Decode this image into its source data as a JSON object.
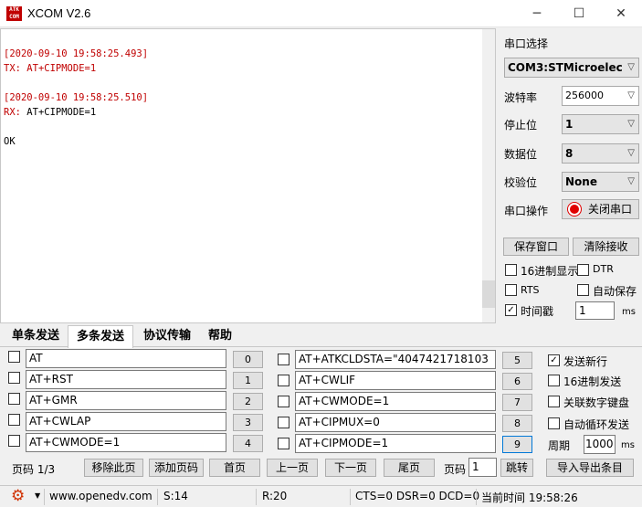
{
  "window": {
    "title": "XCOM V2.6",
    "icon_text_top": "ATK",
    "icon_text_bottom": "COM",
    "minimize": "─",
    "maximize": "☐",
    "close": "✕"
  },
  "receive": {
    "lines": [
      {
        "text": "[2020-09-10 19:58:25.493]",
        "color": "#c00000"
      },
      {
        "prefix": "TX: ",
        "text": "AT+CIPMODE=1",
        "color": "#c00000"
      },
      {
        "text": "[2020-09-10 19:58:25.510]",
        "color": "#c00000"
      },
      {
        "prefix": "RX: ",
        "text": "AT+CIPMODE=1",
        "color": "#000000"
      },
      {
        "text": "OK",
        "color": "#000000"
      }
    ]
  },
  "serial": {
    "select_label": "串口选择",
    "port": "COM3:STMicroelec",
    "baud_label": "波特率",
    "baud": "256000",
    "stop_label": "停止位",
    "stop": "1",
    "data_label": "数据位",
    "data_bits": "8",
    "parity_label": "校验位",
    "parity": "None",
    "op_label": "串口操作",
    "op_button": "关闭串口",
    "save_window": "保存窗口",
    "clear_receive": "清除接收",
    "hex_display": "16进制显示",
    "dtr": "DTR",
    "rts": "RTS",
    "auto_save": "自动保存",
    "timestamp": "时间戳",
    "timestamp_checked": true,
    "timestamp_value": "1",
    "timestamp_unit": "ms"
  },
  "tabs": [
    "单条发送",
    "多条发送",
    "协议传输",
    "帮助"
  ],
  "active_tab": 1,
  "multi": {
    "left": [
      {
        "cmd": "AT",
        "num": "0"
      },
      {
        "cmd": "AT+RST",
        "num": "1"
      },
      {
        "cmd": "AT+GMR",
        "num": "2"
      },
      {
        "cmd": "AT+CWLAP",
        "num": "3"
      },
      {
        "cmd": "AT+CWMODE=1",
        "num": "4"
      }
    ],
    "right": [
      {
        "cmd": "AT+ATKCLDSTA=\"4047421718103",
        "num": "5"
      },
      {
        "cmd": "AT+CWLIF",
        "num": "6"
      },
      {
        "cmd": "AT+CWMODE=1",
        "num": "7"
      },
      {
        "cmd": "AT+CIPMUX=0",
        "num": "8"
      },
      {
        "cmd": "AT+CIPMODE=1",
        "num": "9"
      }
    ],
    "send_newline": "发送新行",
    "send_newline_checked": true,
    "hex_send": "16进制发送",
    "link_keyboard": "关联数字键盘",
    "auto_loop": "自动循环发送",
    "period_label": "周期",
    "period_value": "1000",
    "period_unit": "ms",
    "page_label": "页码 1/3",
    "remove_page": "移除此页",
    "add_page": "添加页码",
    "first_page": "首页",
    "prev_page": "上一页",
    "next_page": "下一页",
    "last_page": "尾页",
    "page_input_label": "页码",
    "page_input": "1",
    "jump": "跳转",
    "import_export": "导入导出条目"
  },
  "status": {
    "url": "www.openedv.com",
    "sent": "S:14",
    "received": "R:20",
    "lines": "CTS=0 DSR=0 DCD=0",
    "time": "当前时间 19:58:26",
    "gear_color": "#d03000"
  }
}
